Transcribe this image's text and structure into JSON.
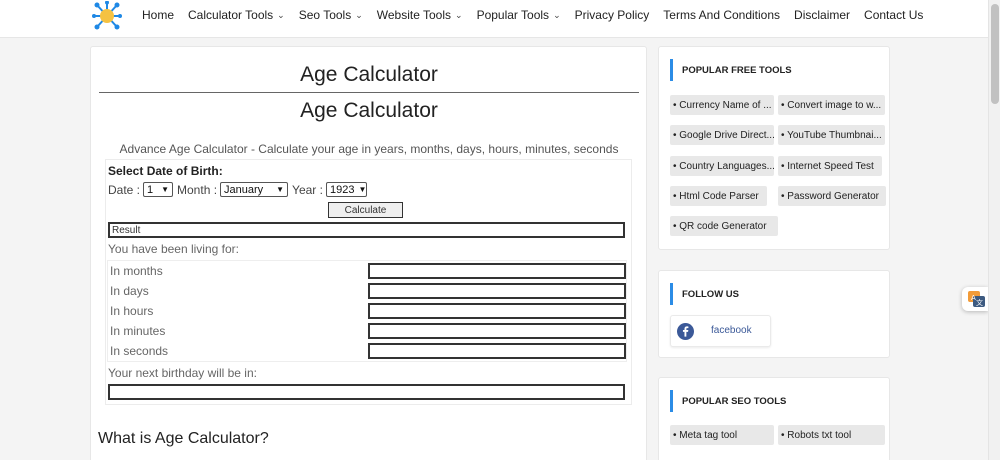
{
  "nav": {
    "items": [
      {
        "label": "Home",
        "dropdown": false
      },
      {
        "label": "Calculator Tools",
        "dropdown": true
      },
      {
        "label": "Seo Tools",
        "dropdown": true
      },
      {
        "label": "Website Tools",
        "dropdown": true
      },
      {
        "label": "Popular Tools",
        "dropdown": true
      },
      {
        "label": "Privacy Policy",
        "dropdown": false
      },
      {
        "label": "Terms And Conditions",
        "dropdown": false
      },
      {
        "label": "Disclaimer",
        "dropdown": false
      },
      {
        "label": "Contact Us",
        "dropdown": false
      }
    ],
    "chevron": "⌄"
  },
  "main": {
    "title": "Age Calculator",
    "heading": "Age Calculator",
    "subtitle": "Advance Age Calculator - Calculate your age in years, months, days, hours, minutes, seconds",
    "calc": {
      "select_label": "Select Date of Birth:",
      "date_label": "Date :",
      "date_value": "1",
      "month_label": "Month :",
      "month_value": "January",
      "year_label": "Year :",
      "year_value": "1923",
      "button": "Calculate",
      "result_label": "Result",
      "living": "You have been living for:",
      "rows": [
        "In months",
        "In days",
        "In hours",
        "In minutes",
        "In seconds"
      ],
      "next_birthday": "Your next birthday will be in:"
    },
    "what_heading": "What is Age Calculator?"
  },
  "sidebar": {
    "popular_free": {
      "title": "POPULAR FREE TOOLS",
      "tools": [
        "• Currency Name of ...",
        "• Convert image to w...",
        "• Google Drive Direct...",
        "• YouTube Thumbnai...",
        "• Country Languages...",
        "• Internet Speed Test",
        "• Html Code Parser",
        "• Password Generator",
        "• QR code Generator"
      ]
    },
    "follow": {
      "title": "FOLLOW US",
      "facebook": "facebook"
    },
    "popular_seo": {
      "title": "POPULAR SEO TOOLS",
      "tools": [
        "• Meta tag tool",
        "• Robots txt tool"
      ]
    }
  },
  "colors": {
    "accent": "#2b8ce6",
    "facebook": "#3b5998",
    "logo": "#1e88e5"
  },
  "icons": {
    "chevron": "chevron-down-icon",
    "facebook": "facebook-icon",
    "logo": "site-logo-icon",
    "translate": "translate-icon"
  }
}
